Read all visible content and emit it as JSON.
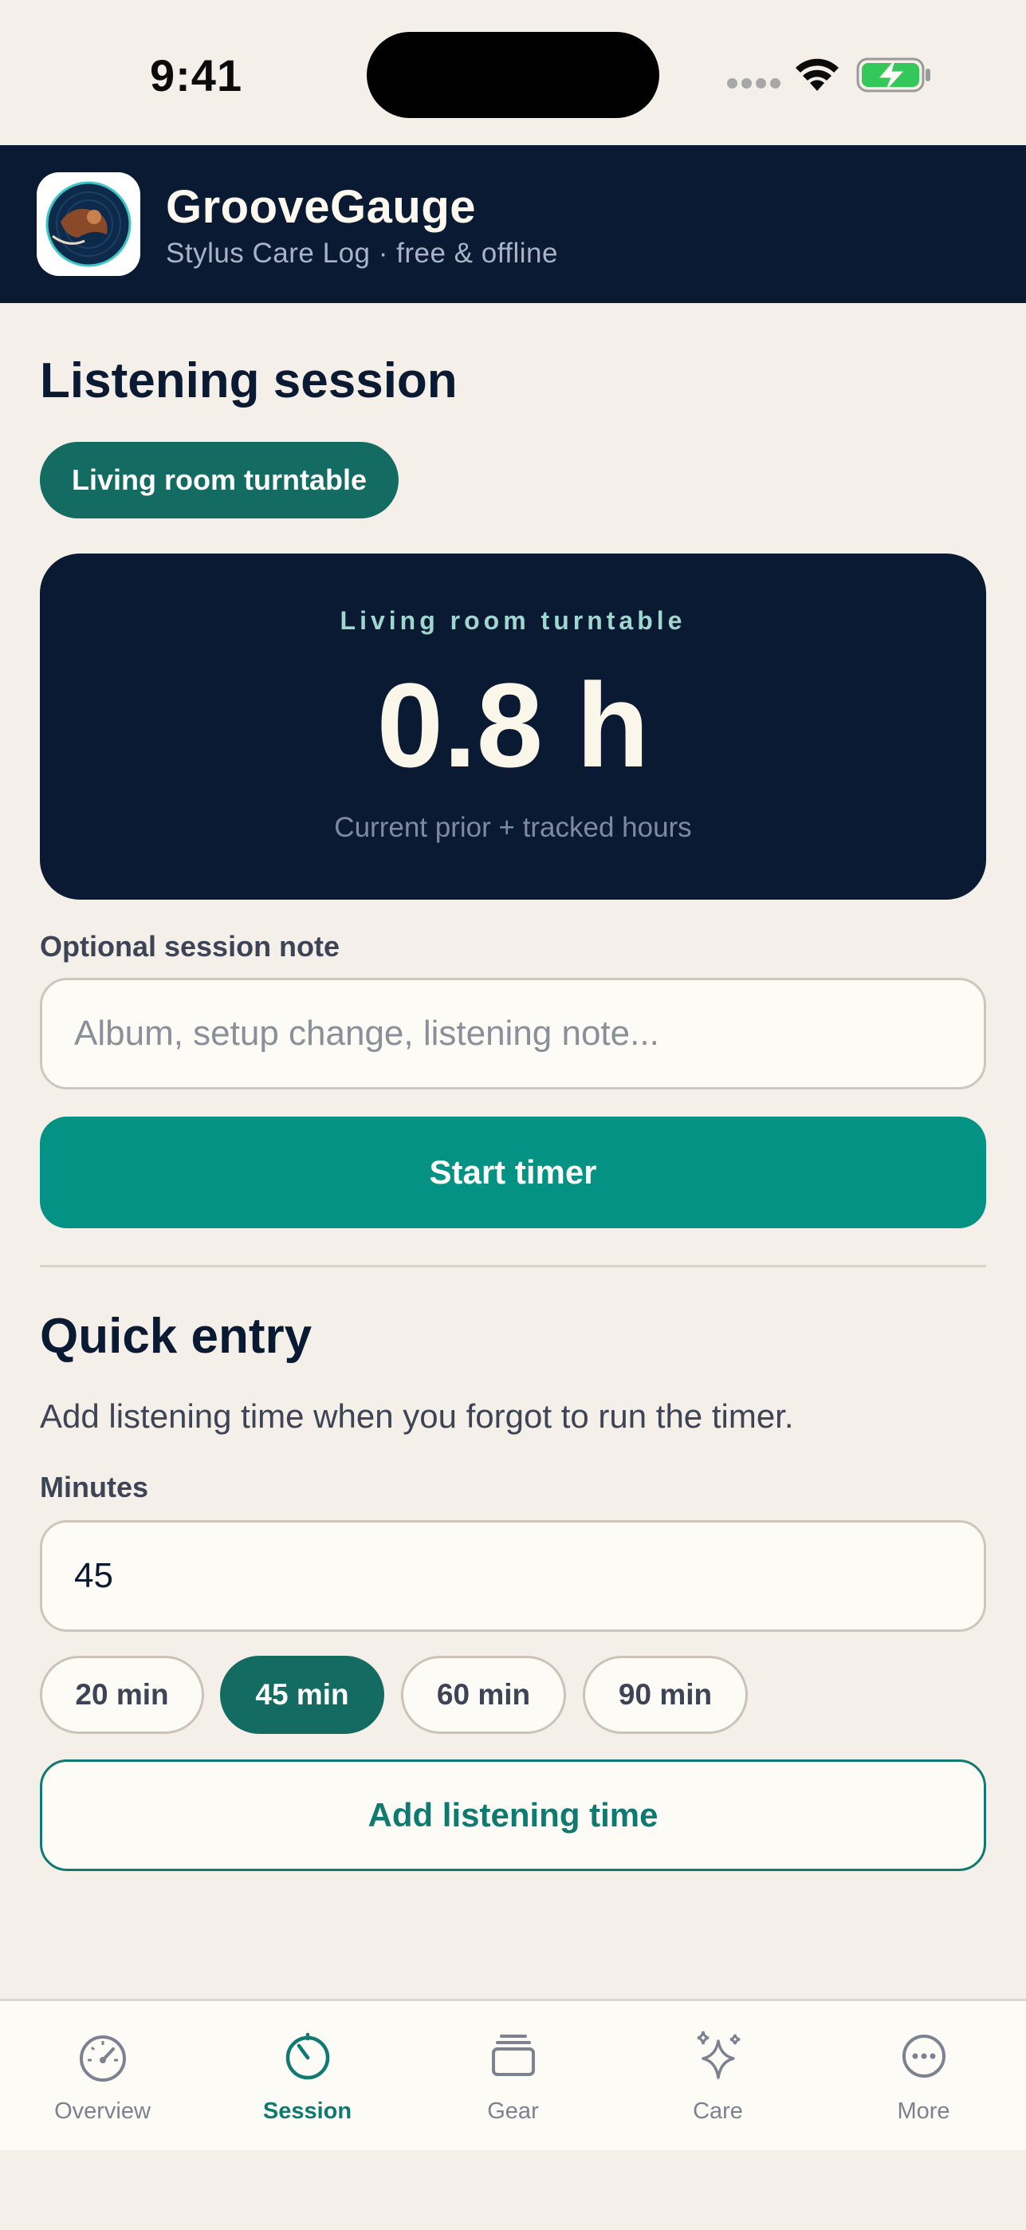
{
  "status_bar": {
    "time": "9:41"
  },
  "header": {
    "app_name": "GrooveGauge",
    "subtitle": "Stylus Care Log · free & offline"
  },
  "session": {
    "title": "Listening session",
    "selected_turntable": "Living room turntable",
    "card": {
      "label": "Living room turntable",
      "value": "0.8 h",
      "caption": "Current prior + tracked hours"
    },
    "note_label": "Optional session note",
    "note_value": "",
    "note_placeholder": "Album, setup change, listening note...",
    "start_button": "Start timer"
  },
  "quick_entry": {
    "title": "Quick entry",
    "description": "Add listening time when you forgot to run the timer.",
    "minutes_label": "Minutes",
    "minutes_value": "45",
    "presets": [
      {
        "label": "20 min",
        "selected": false
      },
      {
        "label": "45 min",
        "selected": true
      },
      {
        "label": "60 min",
        "selected": false
      },
      {
        "label": "90 min",
        "selected": false
      }
    ],
    "add_button": "Add listening time"
  },
  "tabs": [
    {
      "label": "Overview",
      "icon": "gauge-icon",
      "active": false
    },
    {
      "label": "Session",
      "icon": "timer-icon",
      "active": true
    },
    {
      "label": "Gear",
      "icon": "stack-icon",
      "active": false
    },
    {
      "label": "Care",
      "icon": "sparkles-icon",
      "active": false
    },
    {
      "label": "More",
      "icon": "ellipsis-circle-icon",
      "active": false
    }
  ],
  "colors": {
    "background": "#f4efe8",
    "navy": "#0a1a33",
    "teal": "#039284",
    "teal_dark": "#136b62",
    "card_label": "#9fd6cf"
  }
}
